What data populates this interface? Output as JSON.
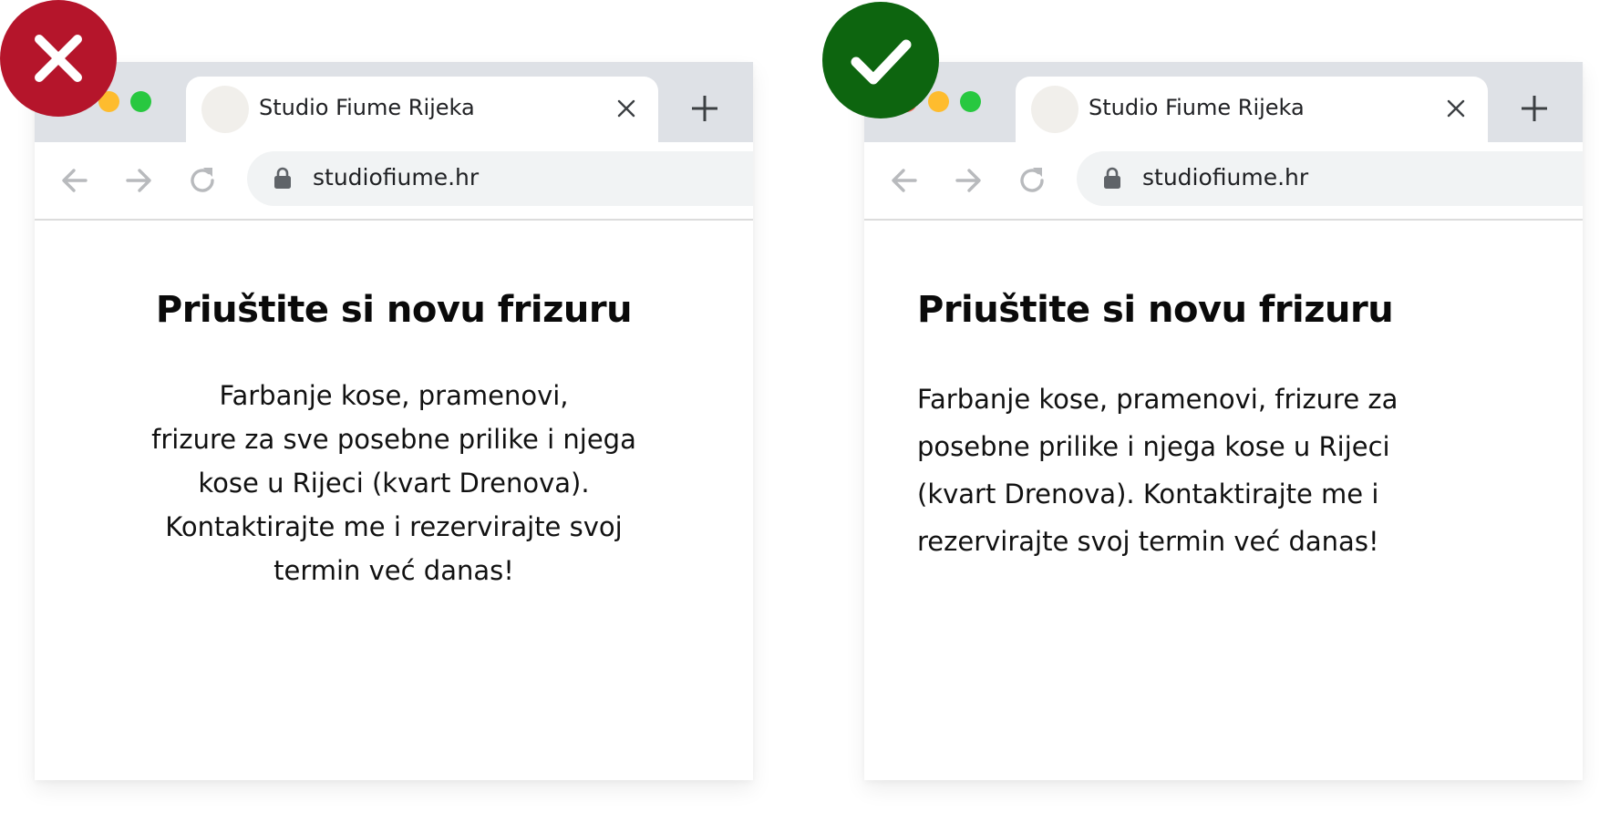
{
  "tab": {
    "title": "Studio Fiume Rijeka"
  },
  "address_bar": {
    "url": "studiofiume.hr"
  },
  "page": {
    "headline": "Priuštite si novu frizuru",
    "paragraph_centered_lines": [
      "Farbanje kose, pramenovi,",
      "frizure za sve posebne prilike i njega",
      "kose u Rijeci (kvart Drenova).",
      "Kontaktirajte me i rezervirajte svoj",
      "termin već danas!"
    ],
    "paragraph_left_lines": [
      "Farbanje kose, pramenovi, frizure za",
      "posebne prilike i njega kose u Rijeci",
      "(kvart Drenova). Kontaktirajte me i",
      "rezervirajte svoj termin već danas!"
    ]
  },
  "examples": {
    "bad": {
      "badge_icon": "x-icon",
      "badge_color": "#b5152b"
    },
    "good": {
      "badge_icon": "check-icon",
      "badge_color": "#0d650f"
    }
  },
  "window_controls": {
    "close_color": "#ff5f57",
    "minimize_color": "#febc2e",
    "maximize_color": "#28c840"
  },
  "icons": [
    "x-icon",
    "check-icon",
    "tab-close-icon",
    "new-tab-icon",
    "back-arrow-icon",
    "forward-arrow-icon",
    "reload-icon",
    "lock-icon",
    "favicon"
  ]
}
